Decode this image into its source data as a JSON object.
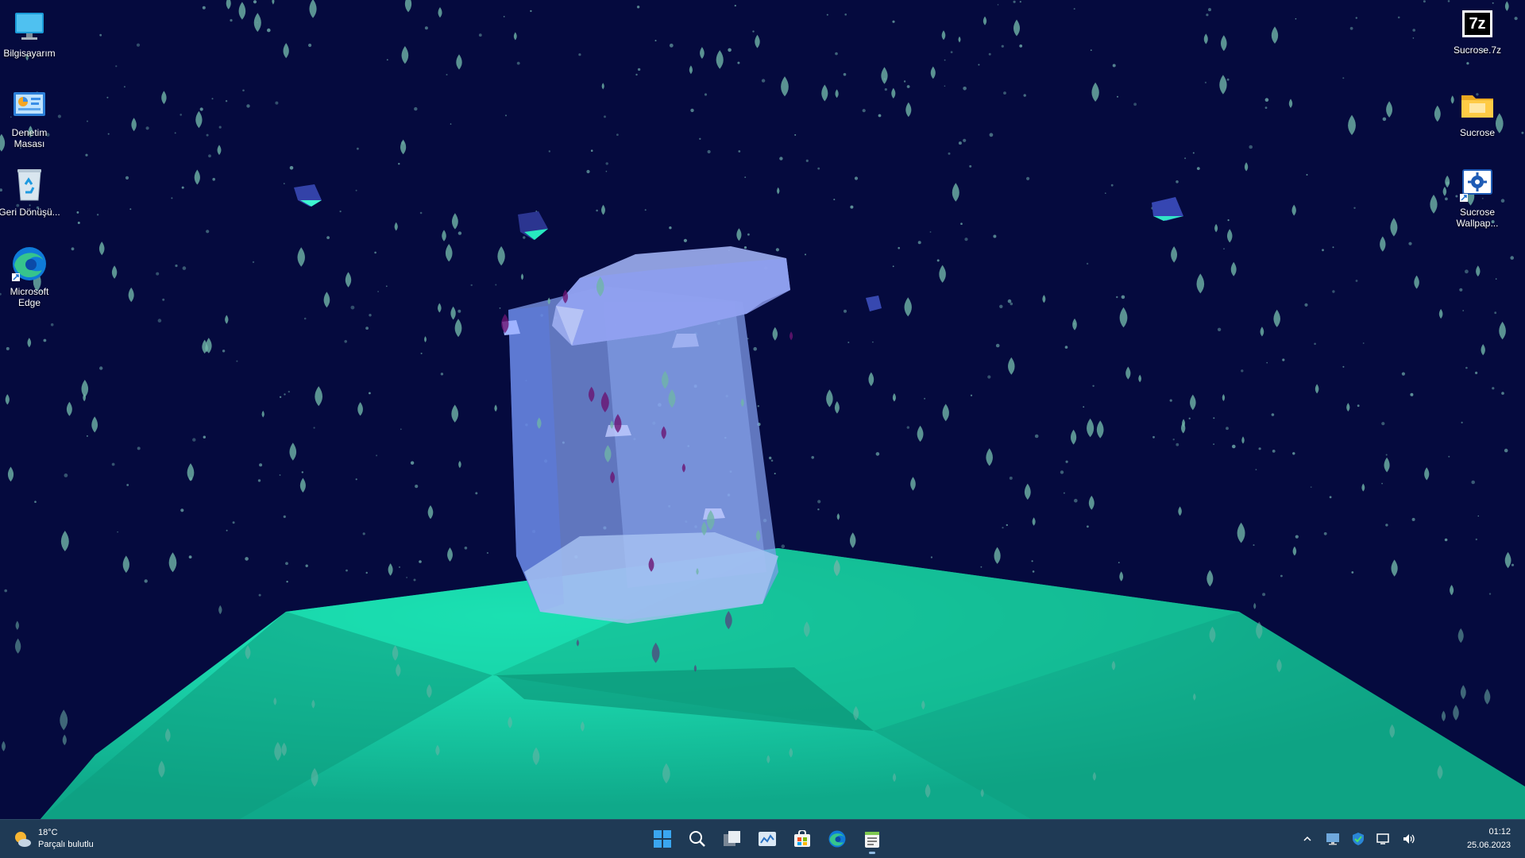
{
  "desktop": {
    "left_icons": [
      {
        "label": "Bilgisayarım",
        "icon": "computer-icon"
      },
      {
        "label": "Denetim Masası",
        "icon": "control-panel-icon"
      },
      {
        "label": "Geri Dönüşü...",
        "icon": "recycle-bin-icon"
      },
      {
        "label": "Microsoft Edge",
        "icon": "edge-icon"
      }
    ],
    "right_icons": [
      {
        "label": "Sucrose.7z",
        "icon": "7z-archive-icon",
        "glyph_text": "7z"
      },
      {
        "label": "Sucrose",
        "icon": "folder-icon"
      },
      {
        "label": "Sucrose Wallpap...",
        "icon": "sucrose-shortcut-icon"
      }
    ]
  },
  "taskbar": {
    "weather": {
      "temperature": "18°C",
      "condition": "Parçalı bulutlu",
      "icon": "partly-cloudy-icon"
    },
    "apps": [
      "start-icon",
      "search-icon",
      "task-view-icon",
      "widgets-icon",
      "store-icon",
      "edge-icon",
      "notepad-icon"
    ],
    "tray_icons": [
      "chevron-up-icon",
      "display-icon",
      "defender-icon",
      "network-icon",
      "volume-icon"
    ],
    "clock": {
      "time": "01:12",
      "date": "25.06.2023"
    }
  },
  "colors": {
    "sky": "#050a3e",
    "ground": "#14c49a",
    "taskbar": "#1f3a55",
    "rain": "#6fb4a8"
  }
}
